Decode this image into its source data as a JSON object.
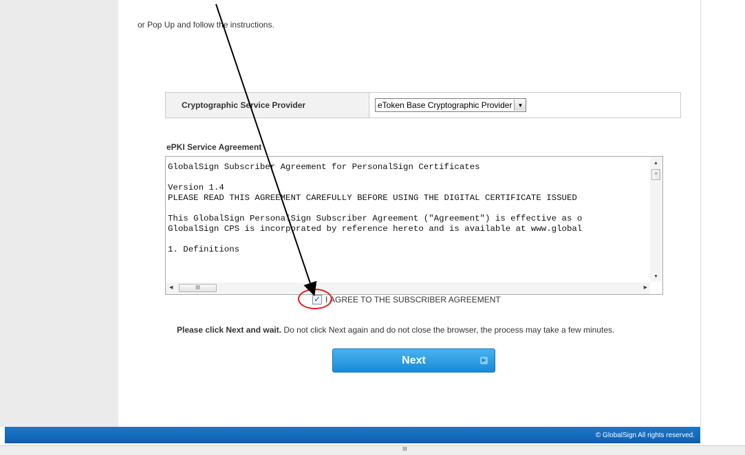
{
  "intro_text": "or Pop Up and follow the instructions.",
  "csp": {
    "label": "Cryptographic Service Provider",
    "selected": "eToken Base Cryptographic Provider",
    "dropdown_glyph": "▼"
  },
  "agreement": {
    "title": "ePKI Service Agreement",
    "lines": [
      "GlobalSign Subscriber Agreement for PersonalSign Certificates",
      "",
      "Version 1.4",
      "PLEASE READ THIS AGREEMENT CAREFULLY BEFORE USING THE DIGITAL CERTIFICATE ISSUED",
      "",
      "This GlobalSign PersonalSign Subscriber Agreement (\"Agreement\") is effective as o",
      "GlobalSign CPS is incorporated by reference hereto and is available at www.global",
      "",
      "1. Definitions"
    ],
    "scroll_grip": "≡",
    "hscroll_grip": "III",
    "agree_label": "I AGREE TO THE SUBSCRIBER AGREEMENT",
    "agree_checked": true
  },
  "notice": {
    "bold": "Please click Next and wait.",
    "rest": " Do not click Next again and do not close the browser, the process may take a few minutes."
  },
  "next_button": {
    "label": "Next",
    "icon": "play-icon"
  },
  "footer": {
    "text": "© GlobalSign All rights reserved."
  },
  "status_grip": "III",
  "annotations": {
    "highlight_color": "#e02020",
    "arrow_color": "#000000"
  }
}
